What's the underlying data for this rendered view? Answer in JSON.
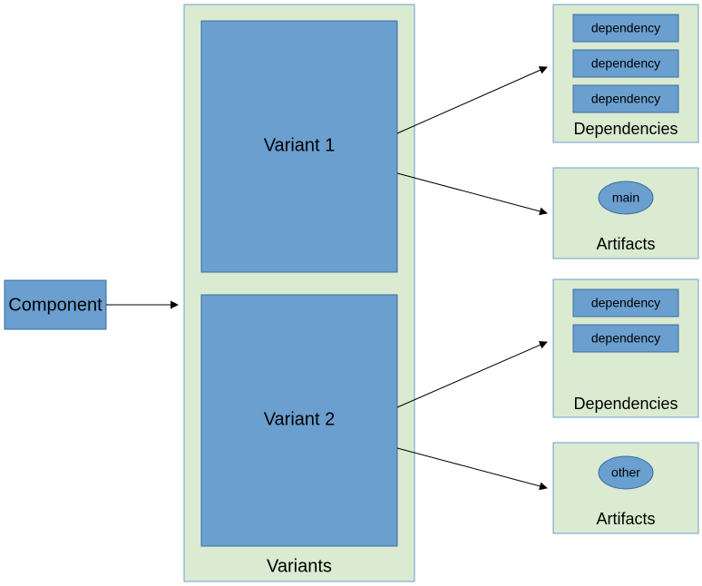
{
  "component": {
    "label": "Component"
  },
  "variants": {
    "label": "Variants",
    "items": [
      {
        "label": "Variant 1"
      },
      {
        "label": "Variant 2"
      }
    ]
  },
  "dependencies_label": "Dependencies",
  "artifacts_label": "Artifacts",
  "dep_label": "dependency",
  "variant1_deps_count": 3,
  "variant2_deps_count": 2,
  "artifact1": {
    "label": "main"
  },
  "artifact2": {
    "label": "other"
  }
}
